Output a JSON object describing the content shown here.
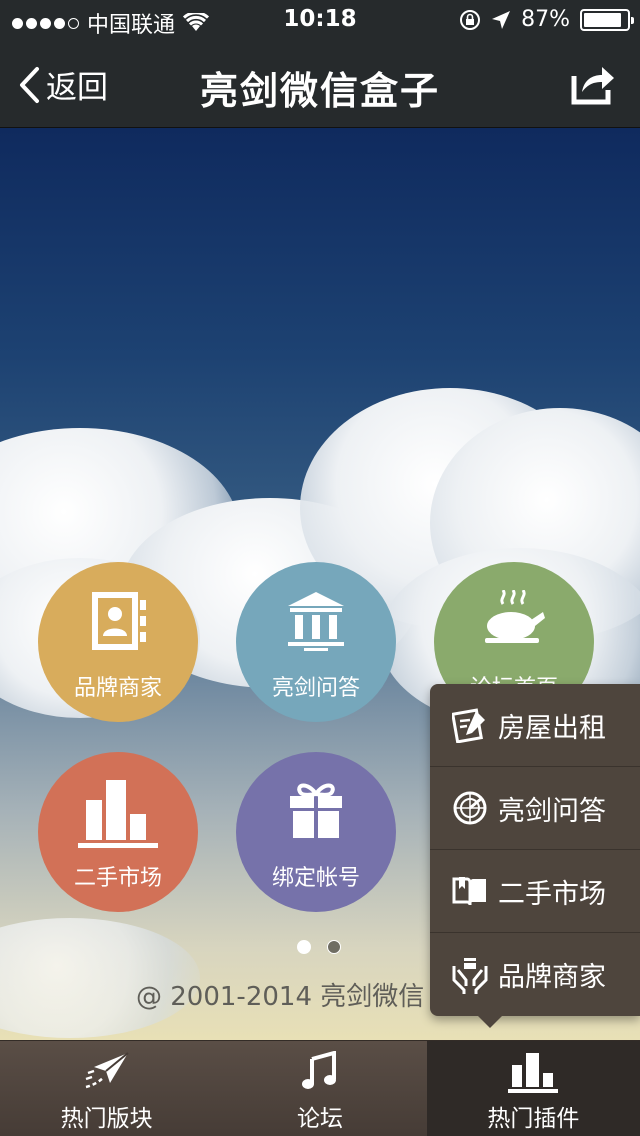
{
  "status_bar": {
    "carrier": "中国联通",
    "time": "10:18",
    "battery": "87%",
    "battery_level": 0.87
  },
  "nav": {
    "back_label": "返回",
    "title": "亮剑微信盒子"
  },
  "apps": [
    {
      "label": "品牌商家",
      "color": "#d8ac5c",
      "icon": "contacts-book-icon"
    },
    {
      "label": "亮剑问答",
      "color": "#76a7bb",
      "icon": "bank-icon"
    },
    {
      "label": "论坛首页",
      "color": "#8aaa6c",
      "icon": "roast-chicken-icon"
    },
    {
      "label": "二手市场",
      "color": "#d27157",
      "icon": "bar-chart-icon"
    },
    {
      "label": "绑定帐号",
      "color": "#7672aa",
      "icon": "gift-icon"
    }
  ],
  "pager": {
    "pages": 2,
    "active": 1
  },
  "copyright": "@ 2001-2014 亮剑微信",
  "popup_menu": [
    {
      "label": "房屋出租",
      "icon": "signature-pen-icon"
    },
    {
      "label": "亮剑问答",
      "icon": "radar-icon"
    },
    {
      "label": "二手市场",
      "icon": "open-book-icon"
    },
    {
      "label": "品牌商家",
      "icon": "hands-gift-icon"
    }
  ],
  "tabs": [
    {
      "label": "热门版块",
      "icon": "paper-plane-icon",
      "active": false
    },
    {
      "label": "论坛",
      "icon": "music-note-icon",
      "active": false
    },
    {
      "label": "热门插件",
      "icon": "bar-chart-icon",
      "active": true
    }
  ]
}
